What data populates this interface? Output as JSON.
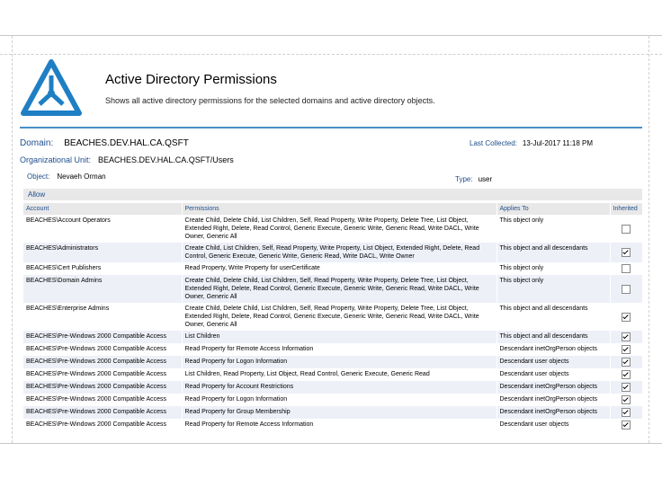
{
  "header": {
    "title": "Active Directory Permissions",
    "subtitle": "Shows all active directory permissions for the selected domains and active directory objects."
  },
  "info": {
    "domain_label": "Domain:",
    "domain_value": "BEACHES.DEV.HAL.CA.QSFT",
    "last_collected_label": "Last Collected:",
    "last_collected_value": "13-Jul-2017 11:18 PM",
    "ou_label": "Organizational Unit:",
    "ou_value": "BEACHES.DEV.HAL.CA.QSFT/Users",
    "object_label": "Object:",
    "object_value": "Nevaeh Orman",
    "type_label": "Type:",
    "type_value": "user"
  },
  "section": {
    "allow_label": "Allow"
  },
  "table": {
    "columns": [
      "Account",
      "Permissions",
      "Applies To",
      "Inherited"
    ],
    "rows": [
      {
        "account": "BEACHES\\Account Operators",
        "permissions": "Create Child, Delete Child, List Children, Self, Read Property, Write Property, Delete Tree, List Object, Extended Right, Delete, Read Control, Generic Execute, Generic Write, Generic Read, Write DACL, Write Owner, Generic All",
        "applies": "This object only",
        "inherited": false
      },
      {
        "account": "BEACHES\\Administrators",
        "permissions": "Create Child, List Children, Self, Read Property, Write Property, List Object, Extended Right, Delete, Read Control, Generic Execute, Generic Write, Generic Read, Write DACL, Write Owner",
        "applies": "This object and all descendants",
        "inherited": true
      },
      {
        "account": "BEACHES\\Cert Publishers",
        "permissions": "Read Property, Write Property for userCertificate",
        "applies": "This object only",
        "inherited": false
      },
      {
        "account": "BEACHES\\Domain Admins",
        "permissions": "Create Child, Delete Child, List Children, Self, Read Property, Write Property, Delete Tree, List Object, Extended Right, Delete, Read Control, Generic Execute, Generic Write, Generic Read, Write DACL, Write Owner, Generic All",
        "applies": "This object only",
        "inherited": false
      },
      {
        "account": "BEACHES\\Enterprise Admins",
        "permissions": "Create Child, Delete Child, List Children, Self, Read Property, Write Property, Delete Tree, List Object, Extended Right, Delete, Read Control, Generic Execute, Generic Write, Generic Read, Write DACL, Write Owner, Generic All",
        "applies": "This object and all descendants",
        "inherited": true
      },
      {
        "account": "BEACHES\\Pre-Windows 2000 Compatible Access",
        "permissions": "List Children",
        "applies": "This object and all descendants",
        "inherited": true
      },
      {
        "account": "BEACHES\\Pre-Windows 2000 Compatible Access",
        "permissions": "Read Property for Remote Access Information",
        "applies": "Descendant inetOrgPerson objects",
        "inherited": true
      },
      {
        "account": "BEACHES\\Pre-Windows 2000 Compatible Access",
        "permissions": "Read Property for Logon Information",
        "applies": "Descendant user objects",
        "inherited": true
      },
      {
        "account": "BEACHES\\Pre-Windows 2000 Compatible Access",
        "permissions": "List Children, Read Property, List Object, Read Control, Generic Execute, Generic Read",
        "applies": "Descendant user objects",
        "inherited": true
      },
      {
        "account": "BEACHES\\Pre-Windows 2000 Compatible Access",
        "permissions": "Read Property for Account Restrictions",
        "applies": "Descendant inetOrgPerson objects",
        "inherited": true
      },
      {
        "account": "BEACHES\\Pre-Windows 2000 Compatible Access",
        "permissions": "Read Property for Logon Information",
        "applies": "Descendant inetOrgPerson objects",
        "inherited": true
      },
      {
        "account": "BEACHES\\Pre-Windows 2000 Compatible Access",
        "permissions": "Read Property for Group Membership",
        "applies": "Descendant inetOrgPerson objects",
        "inherited": true
      },
      {
        "account": "BEACHES\\Pre-Windows 2000 Compatible Access",
        "permissions": "Read Property for Remote Access Information",
        "applies": "Descendant user objects",
        "inherited": true
      }
    ]
  },
  "colors": {
    "accent": "#1f4e8c",
    "rule": "#4a8ec7",
    "logo": "#1f7fc4"
  }
}
